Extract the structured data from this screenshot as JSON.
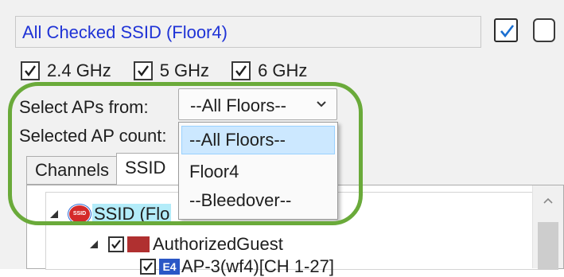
{
  "header": {
    "title": "All Checked SSID (Floor4)",
    "select_all_checked": true,
    "select_none_checked": false
  },
  "bands": [
    {
      "label": "2.4 GHz",
      "checked": true
    },
    {
      "label": "5 GHz",
      "checked": true
    },
    {
      "label": "6 GHz",
      "checked": true
    }
  ],
  "select_aps": {
    "label": "Select APs from:",
    "value": "--All Floors--",
    "options": [
      "--All Floors--",
      "Floor4",
      "--Bleedover--"
    ],
    "selected_index": 0
  },
  "selected_ap_count": {
    "label": "Selected AP count:"
  },
  "tabs": [
    {
      "label": "Channels",
      "active": false
    },
    {
      "label": "SSID",
      "active": true
    }
  ],
  "tree": {
    "root_label": "SSID (Flo",
    "root_badge": "SSID",
    "child_label": "AuthorizedGuest",
    "leaf_label": "AP-3(wf4)[CH 1-27]",
    "leaf_badge": "E4"
  },
  "colors": {
    "title_text": "#1f33d6",
    "highlight_ring": "#6aaa3a",
    "dropdown_selected": "#cce8ff"
  }
}
